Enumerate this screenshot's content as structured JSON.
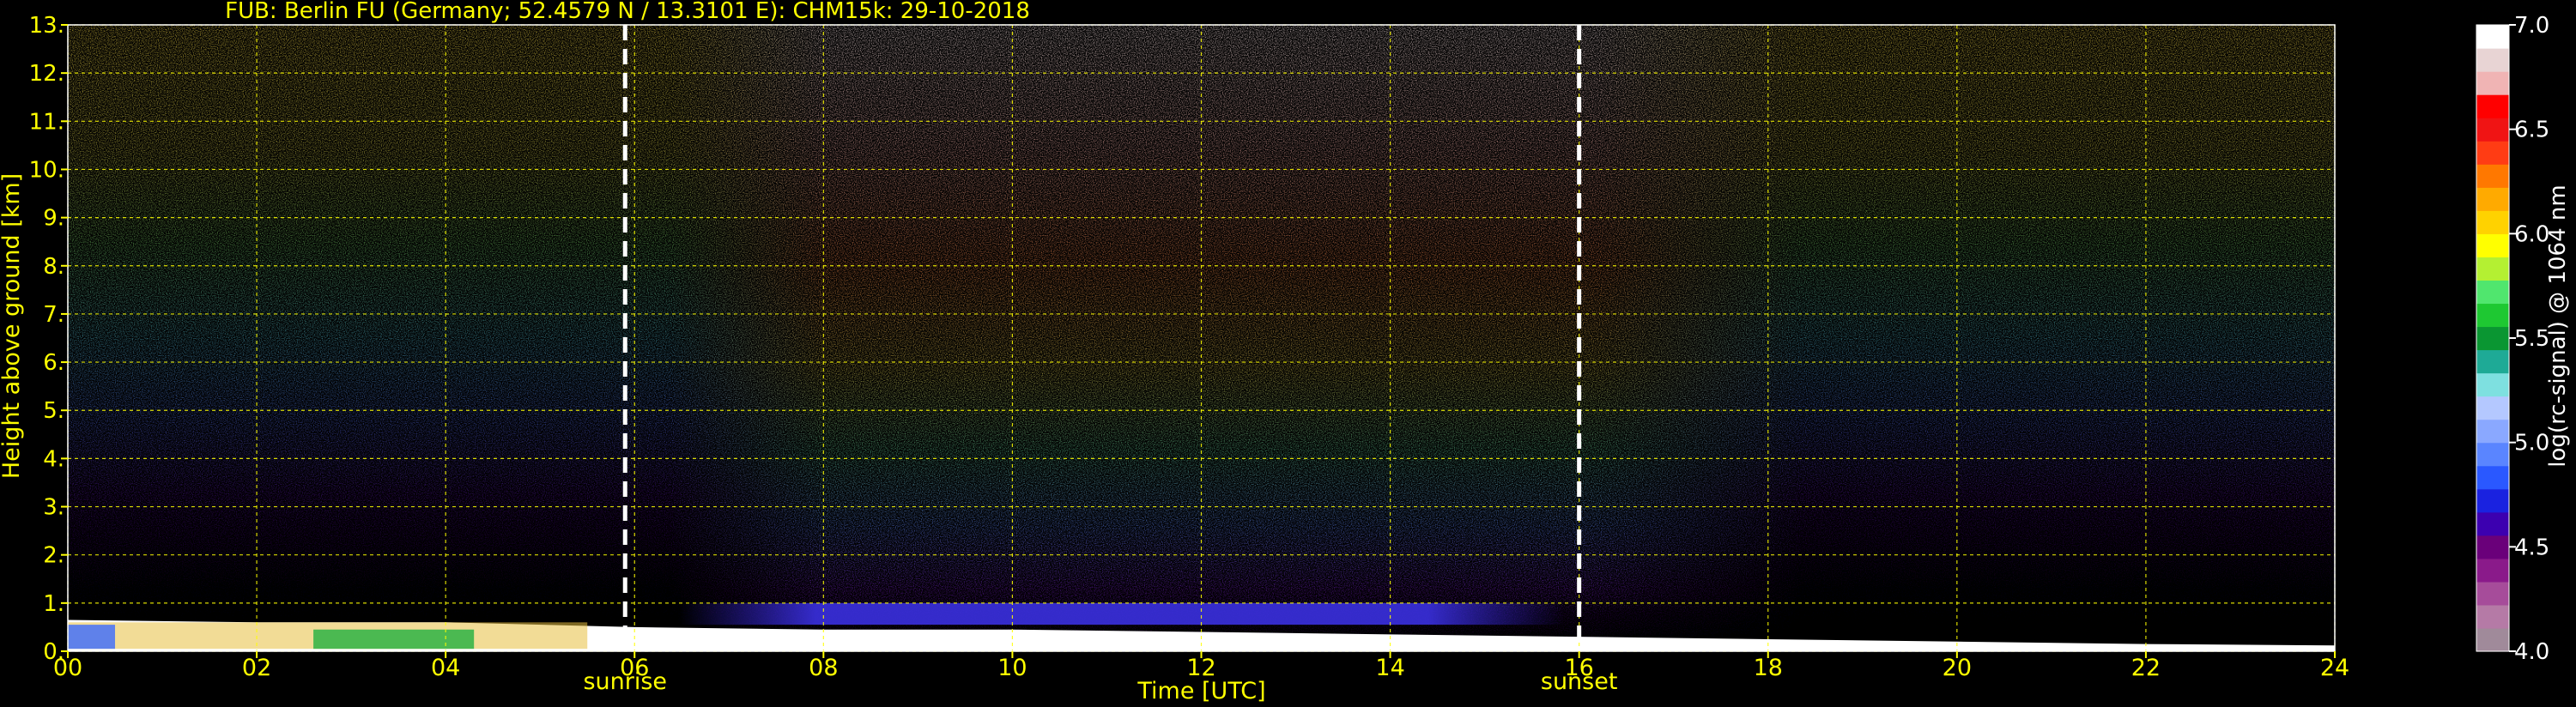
{
  "chart_data": {
    "type": "heatmap",
    "title": "FUB: Berlin FU (Germany; 52.4579 N / 13.3101 E):    CHM15k: 29-10-2018",
    "xlabel": "Time [UTC]",
    "ylabel": "Height above ground [km]",
    "xlim": [
      0,
      24
    ],
    "ylim": [
      0,
      13
    ],
    "x_ticks": [
      "00",
      "02",
      "04",
      "06",
      "08",
      "10",
      "12",
      "14",
      "16",
      "18",
      "20",
      "22",
      "24"
    ],
    "y_ticks": [
      "0.",
      "1.",
      "2.",
      "3.",
      "4.",
      "5.",
      "6.",
      "7.",
      "8.",
      "9.",
      "10.",
      "11.",
      "12.",
      "13."
    ],
    "grid": true,
    "annotations": [
      {
        "label": "sunrise",
        "x": 5.9
      },
      {
        "label": "sunset",
        "x": 16.0
      }
    ],
    "colorbar": {
      "label": "log(rc-signal) @ 1064 nm",
      "range": [
        4.0,
        7.0
      ],
      "ticks": [
        "4.0",
        "4.5",
        "5.0",
        "5.5",
        "6.0",
        "6.5",
        "7.0"
      ],
      "colors": [
        "#a08a9a",
        "#b57aa6",
        "#a64c9a",
        "#8a1a8a",
        "#6a007a",
        "#3c00b0",
        "#1a22e0",
        "#2a58ff",
        "#5a85ff",
        "#8aa8ff",
        "#b4c8ff",
        "#7ee0e0",
        "#1eaa96",
        "#0a9632",
        "#1ec832",
        "#50e66e",
        "#b4f032",
        "#ffff00",
        "#ffd200",
        "#ffaa00",
        "#ff7800",
        "#ff3c14",
        "#f01414",
        "#ff0000",
        "#f0b4b4",
        "#e8d4d4",
        "#ffffff"
      ]
    },
    "boundary_layer_top_km": [
      [
        0,
        0.65
      ],
      [
        2,
        0.6
      ],
      [
        4,
        0.6
      ],
      [
        6,
        0.5
      ],
      [
        8,
        0.45
      ],
      [
        10,
        0.45
      ],
      [
        12,
        0.4
      ],
      [
        14,
        0.35
      ],
      [
        16,
        0.3
      ],
      [
        18,
        0.25
      ],
      [
        20,
        0.2
      ],
      [
        22,
        0.15
      ],
      [
        24,
        0.12
      ]
    ]
  }
}
